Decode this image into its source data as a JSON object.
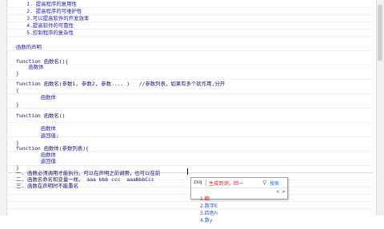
{
  "editor": {
    "lines": [
      "     1. 提高程序的复用性",
      "     2. 提高程序的可维护性",
      "     3.可以提高软件的开发效率",
      "     4.提高软件的可靠性",
      "     5.控制程序的复杂性",
      "函数的声明",
      "function 函数名(){",
      "    函数体",
      "}",
      "function 函数名(参数1, 参数2, 参数.... )   //参数列表，如果有多个就作用,分开",
      "{",
      "        函数体",
      "}",
      "function 函数名()",
      "        函数体",
      "        返回值;",
      "}",
      "function 函数体(参数列表){",
      "        函数体",
      "        返回值",
      "}",
      "一. 函数必须调用才能执行。可以在声明之前调用，也可以在前",
      "二. 函数名命名和变量一样。 aaa bbb ccc  aaaBbbCcc",
      "三. 函数在声明时不能重名"
    ]
  },
  "ime": {
    "composition": "zxq",
    "tools": "生成到词，回一",
    "search_label": "搜索",
    "candidates": [
      "1.翻",
      "2.数字E",
      "3.四色h",
      "4.数y"
    ],
    "nav": "< >"
  },
  "icons": {
    "search": "search-icon",
    "scroll": "scrollbar"
  }
}
